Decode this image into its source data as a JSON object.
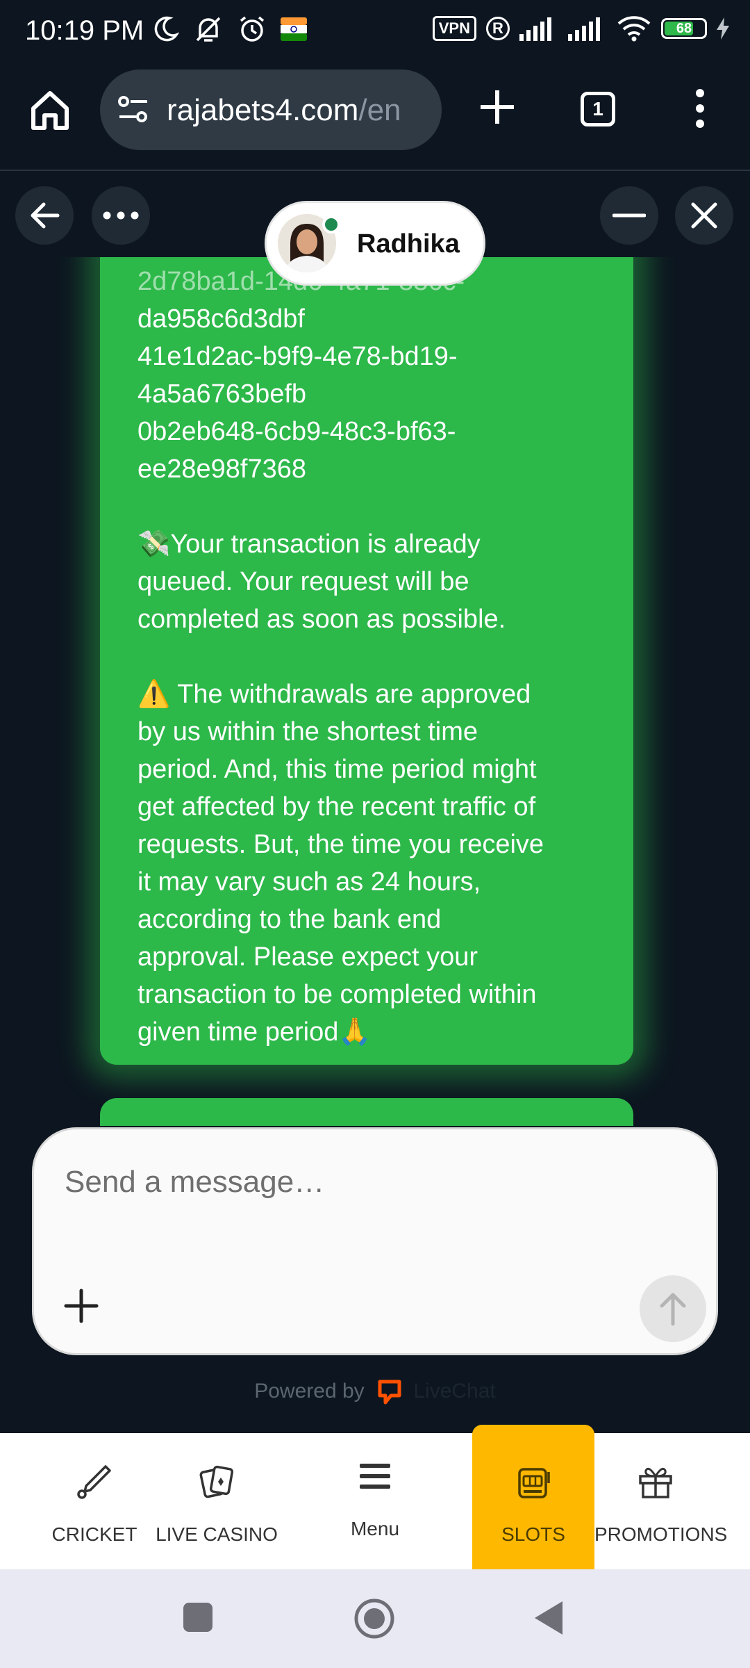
{
  "status_bar": {
    "time": "10:19 PM",
    "vpn": "VPN",
    "registered": "R",
    "battery": "68",
    "icons_left": [
      "moon-icon",
      "notifications-off-icon",
      "alarm-icon",
      "flag-icon"
    ],
    "icons_right": [
      "vpn-icon",
      "registered-icon",
      "signal-icon",
      "signal-icon",
      "wifi-icon",
      "battery-icon",
      "charging-icon"
    ]
  },
  "browser": {
    "url_main": "rajabets4.com",
    "url_rest": "/en",
    "tab_count": "1"
  },
  "chat": {
    "agent_name": "Radhika",
    "message": {
      "partial_line": "2d78ba1d-14d6-4a71-836c-",
      "id_lines": [
        "da958c6d3dbf",
        "41e1d2ac-b9f9-4e78-bd19-",
        "4a5a6763befb",
        "0b2eb648-6cb9-48c3-bf63-",
        "ee28e98f7368"
      ],
      "queued_lines": [
        "💸Your transaction is already",
        "queued. Your request will be",
        "completed as soon as possible."
      ],
      "notice_lines": [
        "⚠️ The withdrawals are approved",
        "by us within the shortest time",
        "period. And, this time period might",
        "get affected by the recent traffic of",
        "requests. But, the time you receive",
        "it may vary such as 24 hours,",
        "according to the bank end",
        "approval. Please expect your",
        "transaction to be completed within",
        "given time period🙏"
      ]
    },
    "composer_placeholder": "Send a message…",
    "powered_by": "Powered by",
    "powered_brand": "LiveChat"
  },
  "bottom_nav": {
    "items": [
      {
        "label": "CRICKET",
        "icon": "cricket-bat-icon"
      },
      {
        "label": "LIVE CASINO",
        "icon": "cards-icon"
      },
      {
        "label": "Menu",
        "icon": "hamburger-icon"
      },
      {
        "label": "SLOTS",
        "icon": "slot-machine-icon",
        "active": true
      },
      {
        "label": "PROMOTIONS",
        "icon": "gift-icon"
      }
    ]
  },
  "colors": {
    "background": "#0d1620",
    "bubble": "#2db84a",
    "active_nav": "#ffb800"
  }
}
